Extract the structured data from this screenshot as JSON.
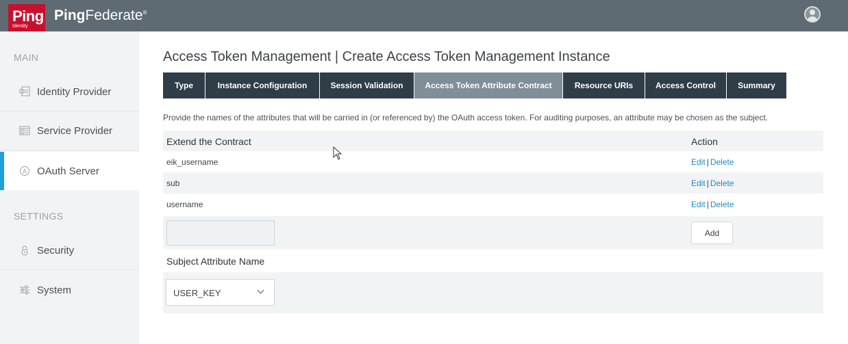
{
  "header": {
    "logo_text": "Ping",
    "logo_sub": "Identity",
    "product_bold": "Ping",
    "product_light": "Federate",
    "product_mark": "®",
    "user_icon": "user-avatar-icon"
  },
  "sidebar": {
    "main_label": "MAIN",
    "settings_label": "SETTINGS",
    "items": [
      {
        "label": "Identity Provider",
        "icon": "identity-provider-icon"
      },
      {
        "label": "Service Provider",
        "icon": "service-provider-icon"
      },
      {
        "label": "OAuth Server",
        "icon": "oauth-icon",
        "active": true
      },
      {
        "label": "Security",
        "icon": "lock-icon"
      },
      {
        "label": "System",
        "icon": "sliders-icon"
      }
    ]
  },
  "page": {
    "title": "Access Token Management | Create Access Token Management Instance",
    "description": "Provide the names of the attributes that will be carried in (or referenced by) the OAuth access token. For auditing purposes, an attribute may be chosen as the subject."
  },
  "tabs": [
    {
      "label": "Type"
    },
    {
      "label": "Instance Configuration"
    },
    {
      "label": "Session Validation"
    },
    {
      "label": "Access Token Attribute Contract",
      "active": true
    },
    {
      "label": "Resource URIs"
    },
    {
      "label": "Access Control"
    },
    {
      "label": "Summary"
    }
  ],
  "contract": {
    "col_name": "Extend the Contract",
    "col_action": "Action",
    "rows": [
      {
        "name": "eik_username",
        "edit": "Edit",
        "sep": "|",
        "delete": "Delete"
      },
      {
        "name": "sub",
        "edit": "Edit",
        "sep": "|",
        "delete": "Delete"
      },
      {
        "name": "username",
        "edit": "Edit",
        "sep": "|",
        "delete": "Delete"
      }
    ],
    "new_value": "",
    "add_label": "Add"
  },
  "subject": {
    "label": "Subject Attribute Name",
    "selected": "USER_KEY"
  },
  "colors": {
    "header_bg": "#5f6b73",
    "logo_red": "#c8102e",
    "tab_bg": "#2f3d48",
    "tab_active_bg": "#7f8e99",
    "link": "#1f8ac4",
    "accent": "#1fa0d8"
  }
}
